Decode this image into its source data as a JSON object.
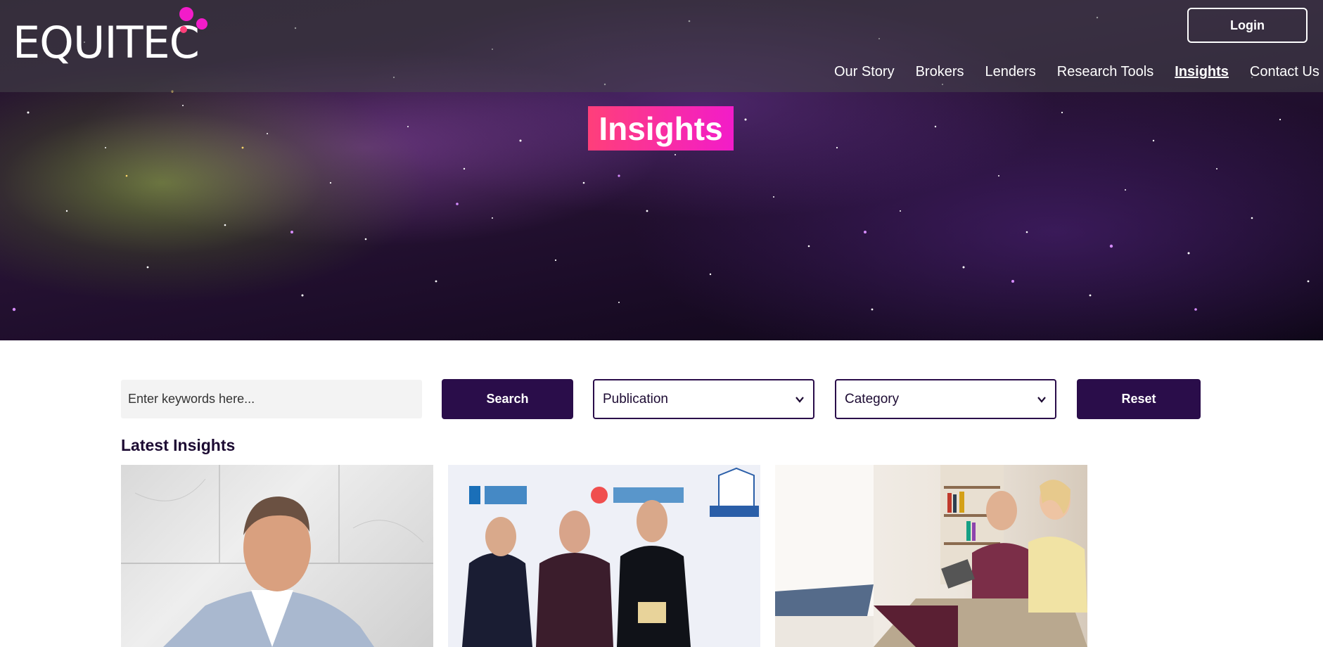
{
  "brand": {
    "name": "EQUITEC",
    "accent_pink": "#f21cc9",
    "accent_red": "#ff3f7a",
    "dark_purple": "#2a0d4a"
  },
  "header": {
    "login_label": "Login",
    "nav": [
      {
        "label": "Our Story",
        "active": false
      },
      {
        "label": "Brokers",
        "active": false
      },
      {
        "label": "Lenders",
        "active": false
      },
      {
        "label": "Research Tools",
        "active": false
      },
      {
        "label": "Insights",
        "active": true
      },
      {
        "label": "Contact Us",
        "active": false
      }
    ]
  },
  "hero": {
    "title": "Insights",
    "background": "starry-night-sky"
  },
  "filters": {
    "search_placeholder": "Enter keywords here...",
    "search_value": "",
    "search_label": "Search",
    "publication_value": "Publication",
    "category_value": "Category",
    "reset_label": "Reset"
  },
  "main": {
    "section_title": "Latest Insights",
    "cards": [
      {
        "image": "man-in-light-blue-blazer-against-marble-wall"
      },
      {
        "image": "three-people-in-formal-wear-at-awards-event"
      },
      {
        "image": "older-couple-relaxing-on-sofa-with-tablet"
      }
    ]
  }
}
